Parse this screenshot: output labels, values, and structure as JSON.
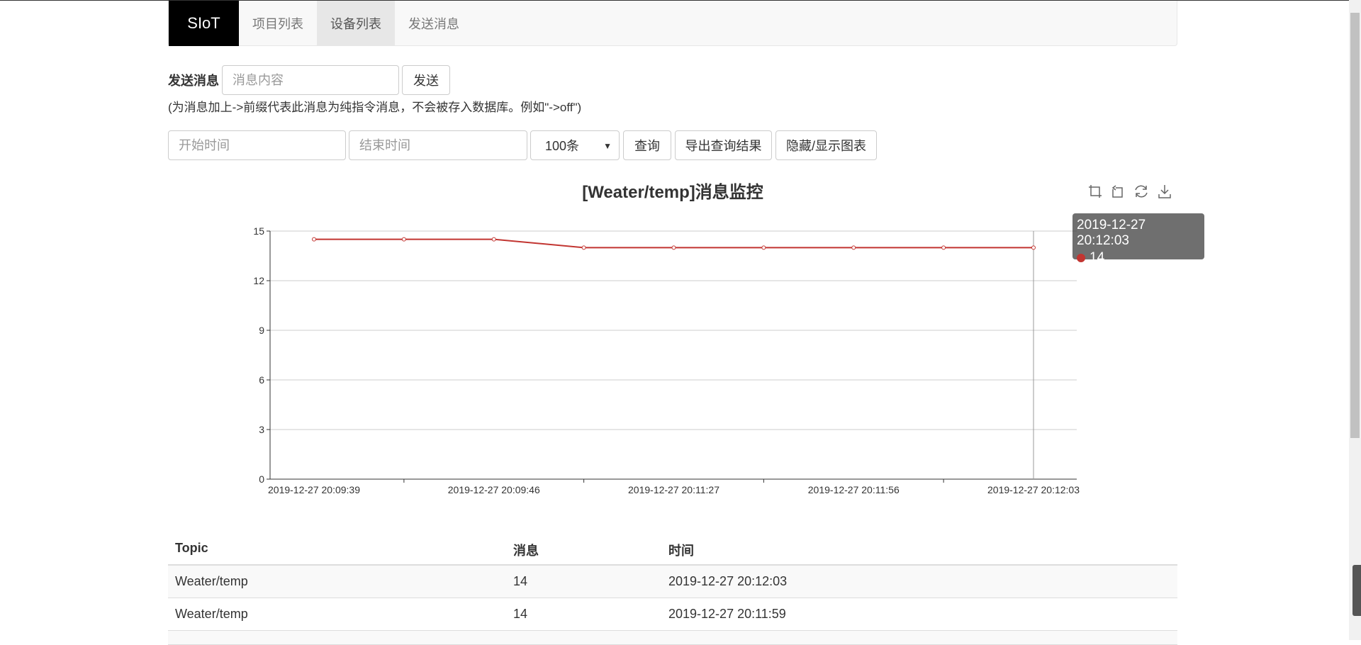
{
  "navbar": {
    "brand": "SIoT",
    "items": [
      {
        "label": "项目列表",
        "active": false
      },
      {
        "label": "设备列表",
        "active": true
      },
      {
        "label": "发送消息",
        "active": false
      }
    ]
  },
  "send": {
    "label": "发送消息",
    "placeholder": "消息内容",
    "button": "发送",
    "hint": "(为消息加上->前缀代表此消息为纯指令消息，不会被存入数据库。例如\"->off\")"
  },
  "query": {
    "start_placeholder": "开始时间",
    "end_placeholder": "结束时间",
    "limit_value": "100条",
    "query_button": "查询",
    "export_button": "导出查询结果",
    "toggle_button": "隐藏/显示图表"
  },
  "toolbox": [
    "zoom-icon",
    "zoom-reset-icon",
    "restore-icon",
    "save-image-icon"
  ],
  "tooltip": {
    "time": "2019-12-27 20:12:03",
    "value": "14"
  },
  "chart_data": {
    "type": "line",
    "title": "[Weater/temp]消息监控",
    "x_tick_labels": [
      "2019-12-27 20:09:39",
      "2019-12-27 20:09:46",
      "2019-12-27 20:11:27",
      "2019-12-27 20:11:56",
      "2019-12-27 20:12:03"
    ],
    "y_ticks": [
      0,
      3,
      6,
      9,
      12,
      15
    ],
    "ylim": [
      0,
      15
    ],
    "series": [
      {
        "values": [
          14.5,
          14.5,
          14.5,
          14,
          14,
          14,
          14,
          14,
          14
        ],
        "color": "#c23531"
      }
    ],
    "grid": true
  },
  "table": {
    "headers": [
      "Topic",
      "消息",
      "时间"
    ],
    "rows": [
      {
        "topic": "Weater/temp",
        "message": "14",
        "time": "2019-12-27 20:12:03"
      },
      {
        "topic": "Weater/temp",
        "message": "14",
        "time": "2019-12-27 20:11:59"
      }
    ]
  }
}
